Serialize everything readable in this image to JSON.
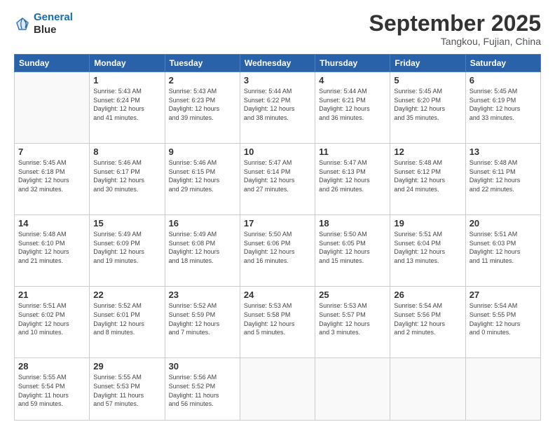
{
  "header": {
    "logo_line1": "General",
    "logo_line2": "Blue",
    "month": "September 2025",
    "location": "Tangkou, Fujian, China"
  },
  "weekdays": [
    "Sunday",
    "Monday",
    "Tuesday",
    "Wednesday",
    "Thursday",
    "Friday",
    "Saturday"
  ],
  "weeks": [
    [
      {
        "day": "",
        "info": ""
      },
      {
        "day": "1",
        "info": "Sunrise: 5:43 AM\nSunset: 6:24 PM\nDaylight: 12 hours\nand 41 minutes."
      },
      {
        "day": "2",
        "info": "Sunrise: 5:43 AM\nSunset: 6:23 PM\nDaylight: 12 hours\nand 39 minutes."
      },
      {
        "day": "3",
        "info": "Sunrise: 5:44 AM\nSunset: 6:22 PM\nDaylight: 12 hours\nand 38 minutes."
      },
      {
        "day": "4",
        "info": "Sunrise: 5:44 AM\nSunset: 6:21 PM\nDaylight: 12 hours\nand 36 minutes."
      },
      {
        "day": "5",
        "info": "Sunrise: 5:45 AM\nSunset: 6:20 PM\nDaylight: 12 hours\nand 35 minutes."
      },
      {
        "day": "6",
        "info": "Sunrise: 5:45 AM\nSunset: 6:19 PM\nDaylight: 12 hours\nand 33 minutes."
      }
    ],
    [
      {
        "day": "7",
        "info": "Sunrise: 5:45 AM\nSunset: 6:18 PM\nDaylight: 12 hours\nand 32 minutes."
      },
      {
        "day": "8",
        "info": "Sunrise: 5:46 AM\nSunset: 6:17 PM\nDaylight: 12 hours\nand 30 minutes."
      },
      {
        "day": "9",
        "info": "Sunrise: 5:46 AM\nSunset: 6:15 PM\nDaylight: 12 hours\nand 29 minutes."
      },
      {
        "day": "10",
        "info": "Sunrise: 5:47 AM\nSunset: 6:14 PM\nDaylight: 12 hours\nand 27 minutes."
      },
      {
        "day": "11",
        "info": "Sunrise: 5:47 AM\nSunset: 6:13 PM\nDaylight: 12 hours\nand 26 minutes."
      },
      {
        "day": "12",
        "info": "Sunrise: 5:48 AM\nSunset: 6:12 PM\nDaylight: 12 hours\nand 24 minutes."
      },
      {
        "day": "13",
        "info": "Sunrise: 5:48 AM\nSunset: 6:11 PM\nDaylight: 12 hours\nand 22 minutes."
      }
    ],
    [
      {
        "day": "14",
        "info": "Sunrise: 5:48 AM\nSunset: 6:10 PM\nDaylight: 12 hours\nand 21 minutes."
      },
      {
        "day": "15",
        "info": "Sunrise: 5:49 AM\nSunset: 6:09 PM\nDaylight: 12 hours\nand 19 minutes."
      },
      {
        "day": "16",
        "info": "Sunrise: 5:49 AM\nSunset: 6:08 PM\nDaylight: 12 hours\nand 18 minutes."
      },
      {
        "day": "17",
        "info": "Sunrise: 5:50 AM\nSunset: 6:06 PM\nDaylight: 12 hours\nand 16 minutes."
      },
      {
        "day": "18",
        "info": "Sunrise: 5:50 AM\nSunset: 6:05 PM\nDaylight: 12 hours\nand 15 minutes."
      },
      {
        "day": "19",
        "info": "Sunrise: 5:51 AM\nSunset: 6:04 PM\nDaylight: 12 hours\nand 13 minutes."
      },
      {
        "day": "20",
        "info": "Sunrise: 5:51 AM\nSunset: 6:03 PM\nDaylight: 12 hours\nand 11 minutes."
      }
    ],
    [
      {
        "day": "21",
        "info": "Sunrise: 5:51 AM\nSunset: 6:02 PM\nDaylight: 12 hours\nand 10 minutes."
      },
      {
        "day": "22",
        "info": "Sunrise: 5:52 AM\nSunset: 6:01 PM\nDaylight: 12 hours\nand 8 minutes."
      },
      {
        "day": "23",
        "info": "Sunrise: 5:52 AM\nSunset: 5:59 PM\nDaylight: 12 hours\nand 7 minutes."
      },
      {
        "day": "24",
        "info": "Sunrise: 5:53 AM\nSunset: 5:58 PM\nDaylight: 12 hours\nand 5 minutes."
      },
      {
        "day": "25",
        "info": "Sunrise: 5:53 AM\nSunset: 5:57 PM\nDaylight: 12 hours\nand 3 minutes."
      },
      {
        "day": "26",
        "info": "Sunrise: 5:54 AM\nSunset: 5:56 PM\nDaylight: 12 hours\nand 2 minutes."
      },
      {
        "day": "27",
        "info": "Sunrise: 5:54 AM\nSunset: 5:55 PM\nDaylight: 12 hours\nand 0 minutes."
      }
    ],
    [
      {
        "day": "28",
        "info": "Sunrise: 5:55 AM\nSunset: 5:54 PM\nDaylight: 11 hours\nand 59 minutes."
      },
      {
        "day": "29",
        "info": "Sunrise: 5:55 AM\nSunset: 5:53 PM\nDaylight: 11 hours\nand 57 minutes."
      },
      {
        "day": "30",
        "info": "Sunrise: 5:56 AM\nSunset: 5:52 PM\nDaylight: 11 hours\nand 56 minutes."
      },
      {
        "day": "",
        "info": ""
      },
      {
        "day": "",
        "info": ""
      },
      {
        "day": "",
        "info": ""
      },
      {
        "day": "",
        "info": ""
      }
    ]
  ]
}
